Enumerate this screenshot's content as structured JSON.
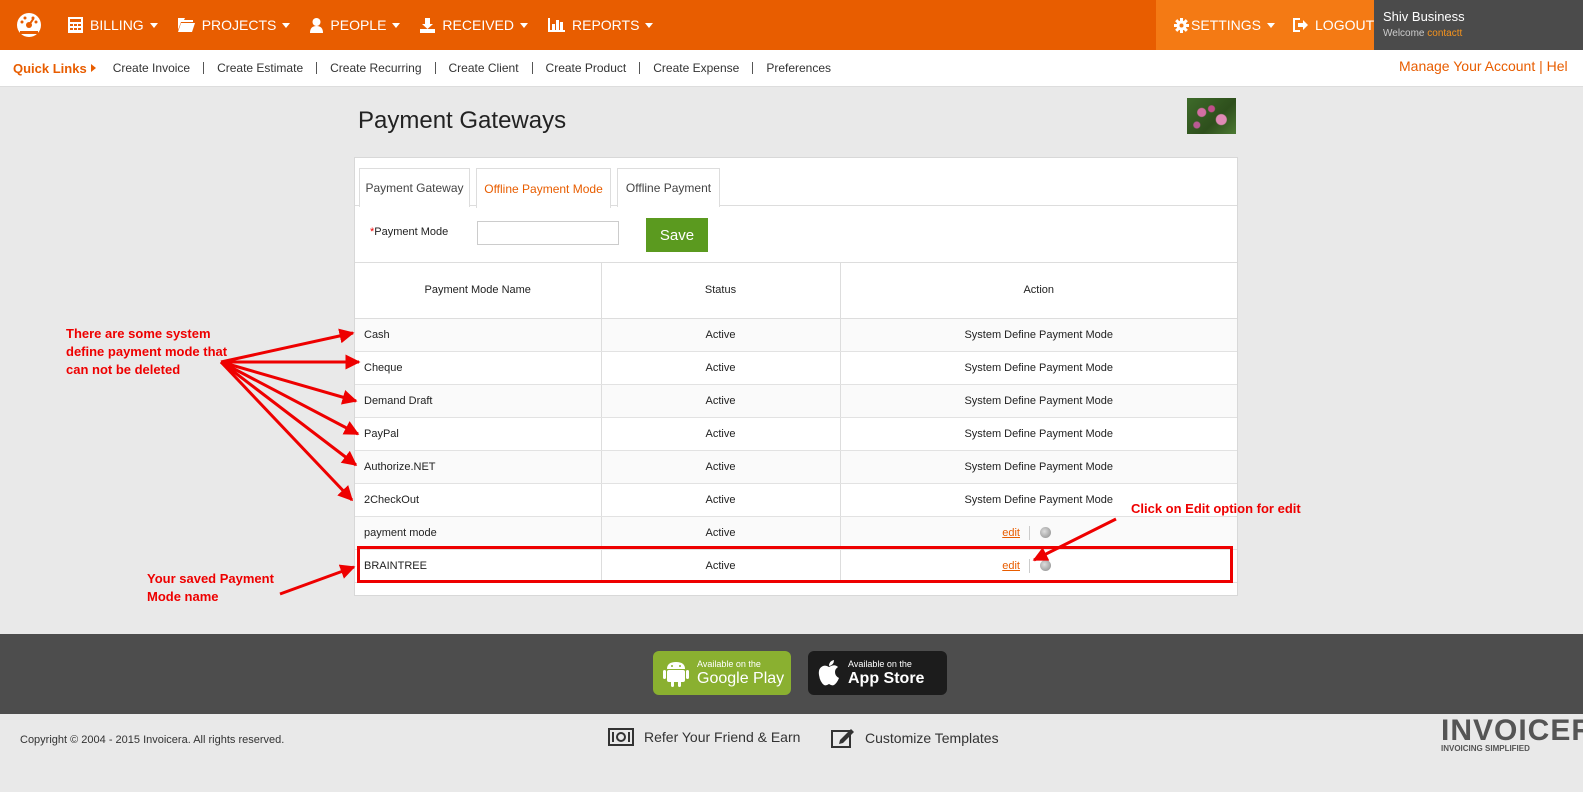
{
  "nav": {
    "items": [
      {
        "label": "BILLING",
        "icon": "calculator-icon"
      },
      {
        "label": "PROJECTS",
        "icon": "folder-icon"
      },
      {
        "label": "PEOPLE",
        "icon": "user-icon"
      },
      {
        "label": "RECEIVED",
        "icon": "download-icon"
      },
      {
        "label": "REPORTS",
        "icon": "bar-chart-icon"
      }
    ],
    "settings_label": "SETTINGS",
    "logout_label": "LOGOUT",
    "user_name": "Shiv Business",
    "welcome_label": "Welcome",
    "welcome_user": "contactt"
  },
  "quick_links": {
    "title": "Quick Links",
    "links": [
      "Create Invoice",
      "Create Estimate",
      "Create Recurring",
      "Create Client",
      "Create Product",
      "Create Expense",
      "Preferences"
    ],
    "manage": "Manage Your Account | Hel"
  },
  "page": {
    "title": "Payment Gateways",
    "tabs": [
      "Payment Gateway",
      "Offline Payment Mode",
      "Offline Payment"
    ],
    "active_tab": "Offline Payment Mode",
    "form": {
      "required_mark": "*",
      "label": "Payment Mode",
      "value": "",
      "save_label": "Save"
    },
    "table": {
      "headers": [
        "Payment Mode Name",
        "Status",
        "Action"
      ],
      "rows": [
        {
          "name": "Cash",
          "status": "Active",
          "action": "System Define Payment Mode"
        },
        {
          "name": "Cheque",
          "status": "Active",
          "action": "System Define Payment Mode"
        },
        {
          "name": "Demand Draft",
          "status": "Active",
          "action": "System Define Payment Mode"
        },
        {
          "name": "PayPal",
          "status": "Active",
          "action": "System Define Payment Mode"
        },
        {
          "name": "Authorize.NET",
          "status": "Active",
          "action": "System Define Payment Mode"
        },
        {
          "name": "2CheckOut",
          "status": "Active",
          "action": "System Define Payment Mode"
        },
        {
          "name": "payment mode",
          "status": "Active",
          "edit_label": "edit"
        },
        {
          "name": "BRAINTREE",
          "status": "Active",
          "edit_label": "edit"
        }
      ]
    }
  },
  "annotations": {
    "system_modes": "There are some system define payment mode that can not be deleted",
    "saved_mode": "Your saved Payment Mode name",
    "edit_hint": "Click on Edit option for edit"
  },
  "footer": {
    "google": {
      "small": "Available on the",
      "big": "Google Play"
    },
    "apple": {
      "small": "Available on the",
      "big": "App Store"
    },
    "copyright": "Copyright © 2004 - 2015 Invoicera. All rights reserved.",
    "refer": "Refer Your Friend & Earn",
    "customize": "Customize Templates",
    "brand": "INVOICERA",
    "tagline": "INVOICING SIMPLIFIED"
  },
  "colors": {
    "brand_orange": "#e85d00",
    "save_green": "#5b9a1f",
    "annotation_red": "#ee0000"
  }
}
